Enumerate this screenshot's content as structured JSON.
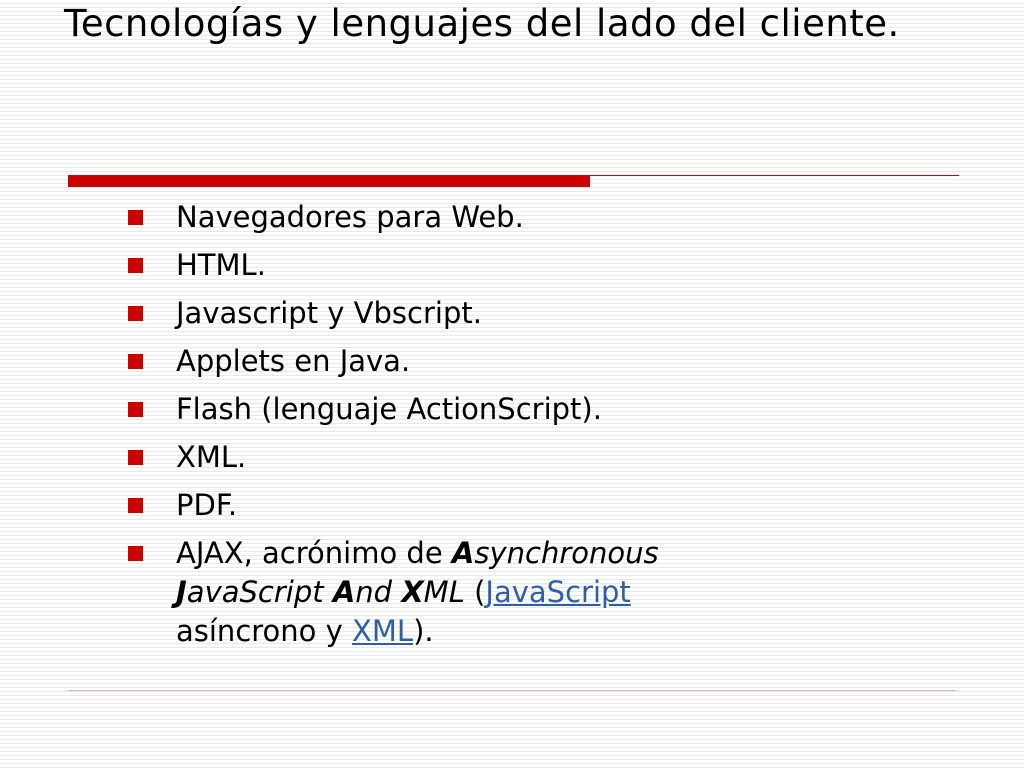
{
  "slide": {
    "title": "Tecnologías y lenguajes del lado del cliente.",
    "accent_color": "#cc0000",
    "link_color": "#2e5ea8",
    "bullet_icon": "red-square-bullet",
    "bullets": [
      "Navegadores para Web.",
      "HTML.",
      "Javascript y Vbscript.",
      "Applets en Java.",
      "Flash (lenguaje ActionScript).",
      "XML.",
      "PDF."
    ],
    "ajax": {
      "prefix": "AJAX, acrónimo de ",
      "a_letter": "A",
      "a_rest": "synchronous",
      "j_letter": "J",
      "j_rest": "avaScript",
      "and_letter": "A",
      "and_rest": "nd",
      "x_letter": "X",
      "x_rest": "ML",
      "open_paren": " (",
      "link_javascript": "JavaScript",
      "middle": " asíncrono y ",
      "link_xml": "XML",
      "close": ")."
    }
  }
}
